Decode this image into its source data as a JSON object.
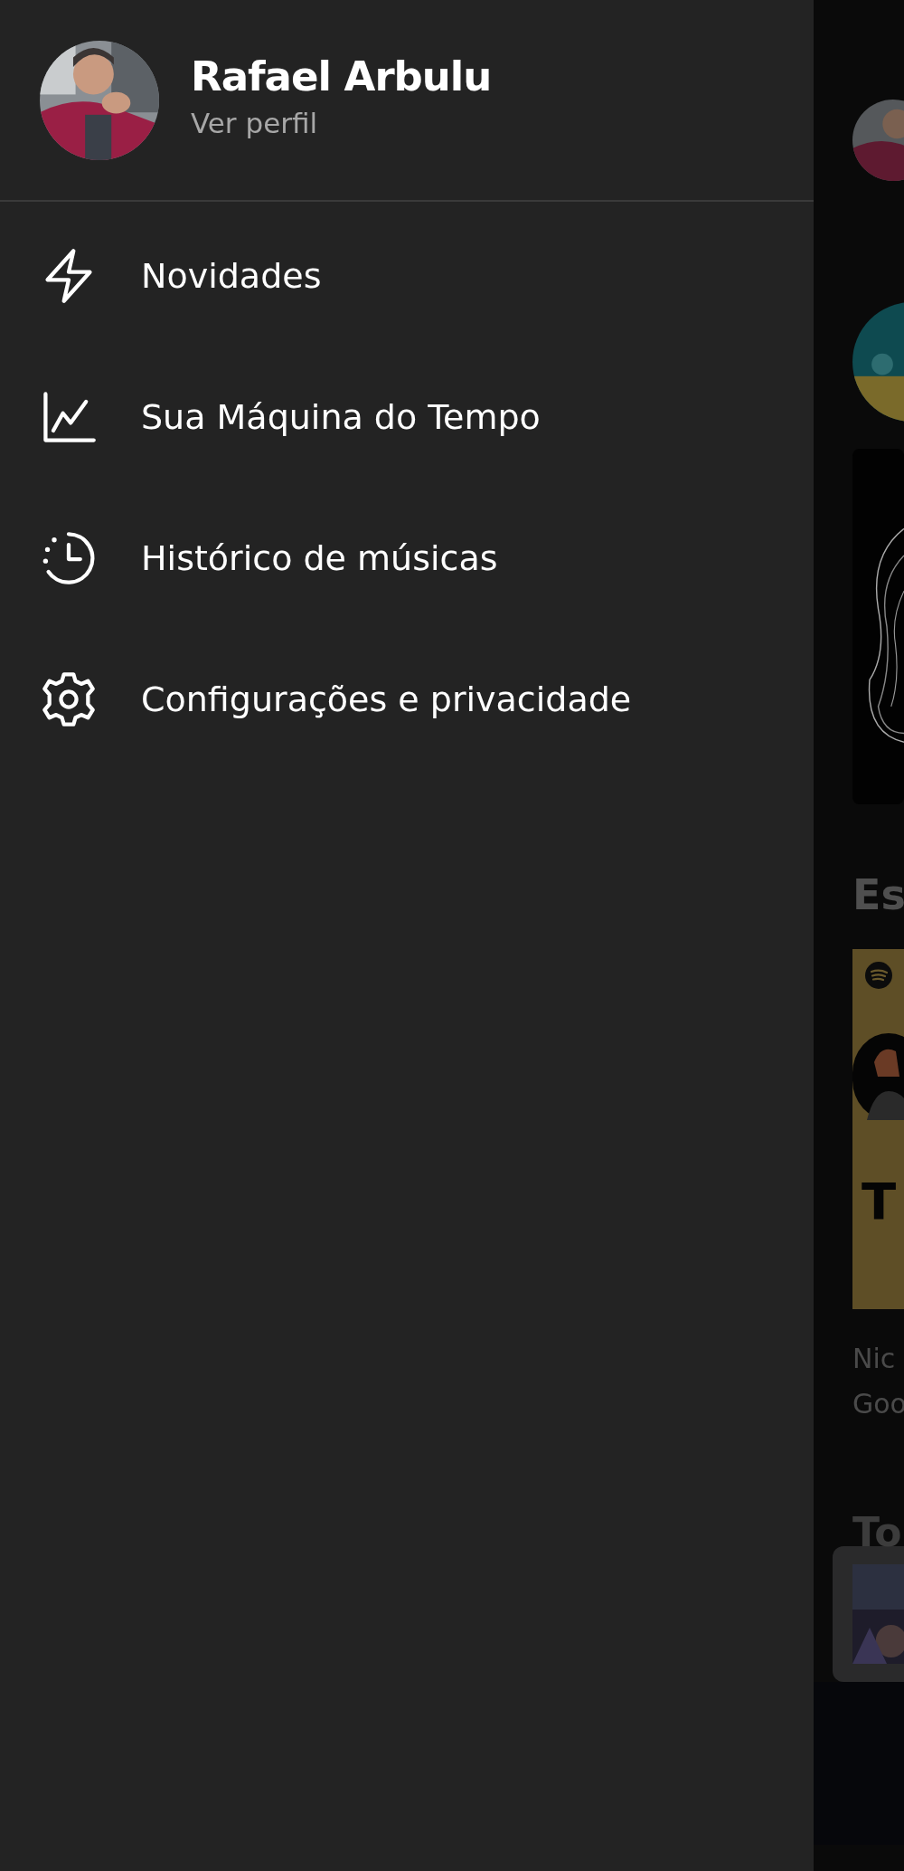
{
  "profile": {
    "name": "Rafael Arbulu",
    "link": "Ver perfil"
  },
  "menu": [
    {
      "label": "Novidades"
    },
    {
      "label": "Sua Máquina do Tempo"
    },
    {
      "label": "Histórico de músicas"
    },
    {
      "label": "Configurações e privacidade"
    }
  ],
  "background_page": {
    "heading_1": "Es",
    "card_title": "T",
    "card_subtitle_lines": [
      "Nic",
      "Goo"
    ],
    "heading_2": "To"
  }
}
